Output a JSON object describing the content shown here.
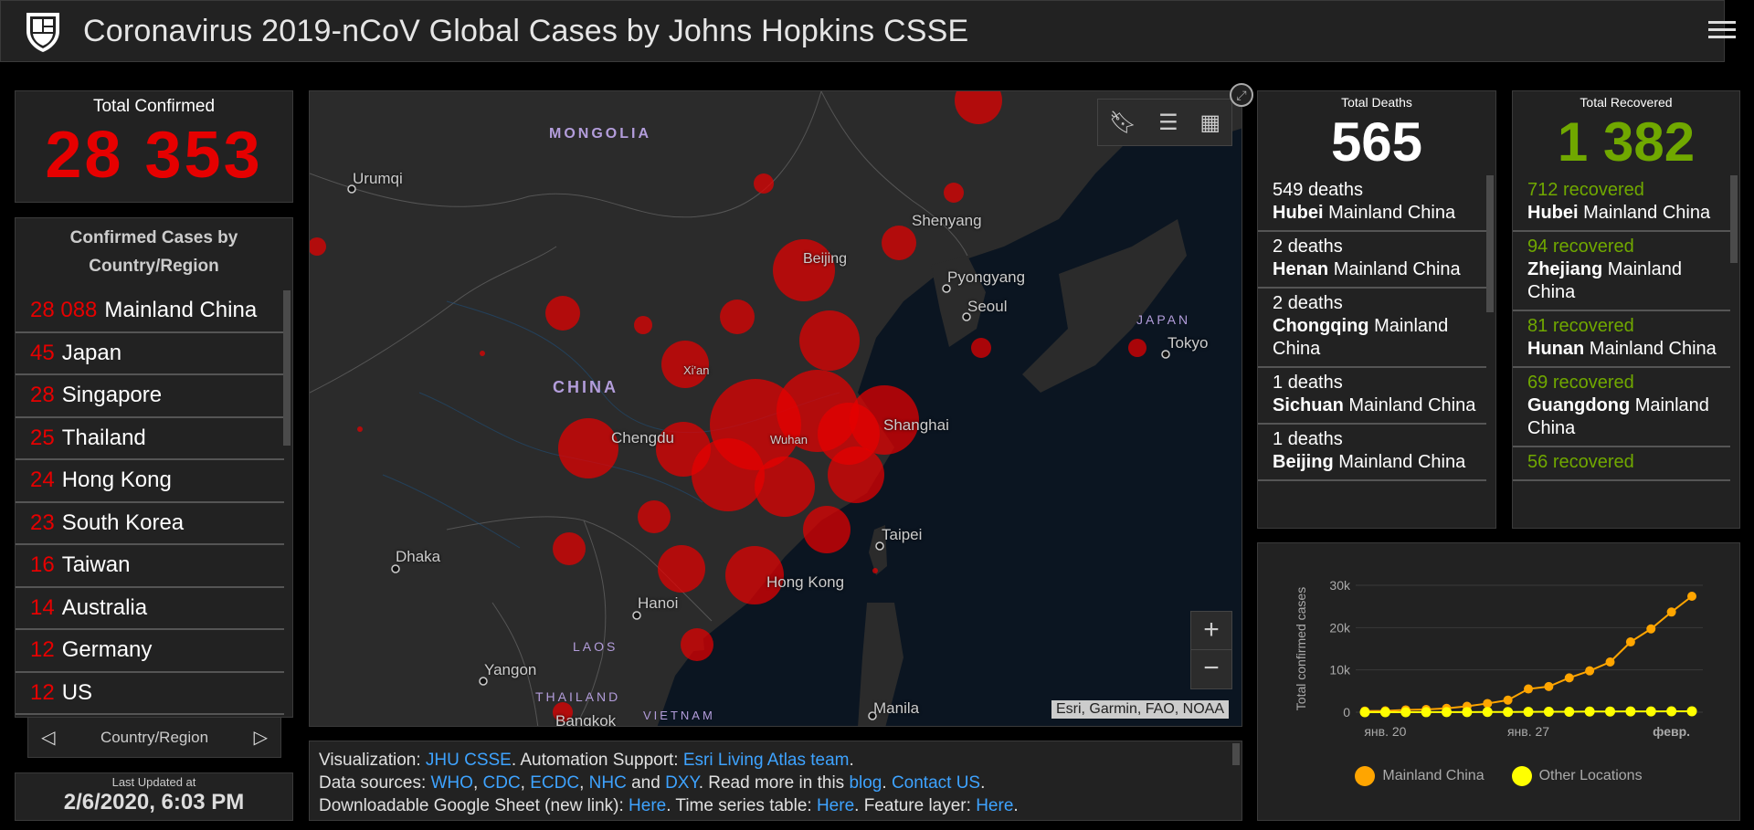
{
  "header": {
    "title": "Coronavirus 2019-nCoV Global Cases by Johns Hopkins CSSE"
  },
  "total_confirmed": {
    "label": "Total Confirmed",
    "value": "28 353"
  },
  "country_panel": {
    "title": "Confirmed Cases by Country/Region",
    "items": [
      {
        "count": "28 088",
        "name": "Mainland China"
      },
      {
        "count": "45",
        "name": "Japan"
      },
      {
        "count": "28",
        "name": "Singapore"
      },
      {
        "count": "25",
        "name": "Thailand"
      },
      {
        "count": "24",
        "name": "Hong Kong"
      },
      {
        "count": "23",
        "name": "South Korea"
      },
      {
        "count": "16",
        "name": "Taiwan"
      },
      {
        "count": "14",
        "name": "Australia"
      },
      {
        "count": "12",
        "name": "Germany"
      },
      {
        "count": "12",
        "name": "US"
      }
    ],
    "pager_label": "Country/Region"
  },
  "last_updated": {
    "label": "Last Updated at",
    "value": "2/6/2020, 6:03 PM"
  },
  "map": {
    "labels": {
      "mongolia": "MONGOLIA",
      "china": "CHINA",
      "japan": "JAPAN",
      "laos": "LAOS",
      "thailand": "THAILAND",
      "vietnam": "VIETNAM",
      "urumqi": "Urumqi",
      "shenyang": "Shenyang",
      "beijing": "Beijing",
      "pyongyang": "Pyongyang",
      "seoul": "Seoul",
      "tokyo": "Tokyo",
      "xian": "Xi'an",
      "chengdu": "Chengdu",
      "wuhan": "Wuhan",
      "shanghai": "Shanghai",
      "taipei": "Taipei",
      "dhaka": "Dhaka",
      "hanoi": "Hanoi",
      "hongkong": "Hong Kong",
      "yangon": "Yangon",
      "bangkok": "Bangkok",
      "manila": "Manila"
    },
    "attribution": "Esri, Garmin, FAO, NOAA",
    "tools": {
      "bookmark_icon": "bookmark-icon",
      "legend_icon": "list-icon",
      "basemap_icon": "basemap-gallery-icon"
    },
    "zoom_in": "+",
    "zoom_out": "−"
  },
  "info": {
    "visualization_label": "Visualization: ",
    "jhu": "JHU CSSE",
    "automation_label": ". Automation Support: ",
    "esri_team": "Esri Living Atlas team",
    "period": ".",
    "sources_label": "Data sources: ",
    "who": "WHO",
    "cdc": "CDC",
    "ecdc": "ECDC",
    "nhc": "NHC",
    "and": " and ",
    "dxy": "DXY",
    "read_more": ". Read more in this ",
    "blog": "blog",
    "contact": "Contact US",
    "sheet_label": "Downloadable Google Sheet (new link): ",
    "here1": "Here",
    "ts_label": ". Time series table: ",
    "here2": "Here",
    "fl_label": ". Feature layer: ",
    "here3": "Here"
  },
  "deaths": {
    "label": "Total Deaths",
    "value": "565",
    "items": [
      {
        "count": "549",
        "unit": "deaths",
        "region": "Hubei",
        "country": "Mainland China"
      },
      {
        "count": "2",
        "unit": "deaths",
        "region": "Henan",
        "country": "Mainland China"
      },
      {
        "count": "2",
        "unit": "deaths",
        "region": "Chongqing",
        "country": "Mainland China"
      },
      {
        "count": "1",
        "unit": "deaths",
        "region": "Sichuan",
        "country": "Mainland China"
      },
      {
        "count": "1",
        "unit": "deaths",
        "region": "Beijing",
        "country": "Mainland China"
      }
    ]
  },
  "recovered": {
    "label": "Total Recovered",
    "value": "1 382",
    "items": [
      {
        "count": "712",
        "unit": "recovered",
        "region": "Hubei",
        "country": "Mainland China"
      },
      {
        "count": "94",
        "unit": "recovered",
        "region": "Zhejiang",
        "country": "Mainland China"
      },
      {
        "count": "81",
        "unit": "recovered",
        "region": "Hunan",
        "country": "Mainland China"
      },
      {
        "count": "69",
        "unit": "recovered",
        "region": "Guangdong",
        "country": "Mainland China"
      },
      {
        "count": "56",
        "unit": "recovered",
        "region": "",
        "country": ""
      }
    ]
  },
  "colors": {
    "confirmed": "#e60000",
    "recovered": "#70a800",
    "mainland": "#ffa500",
    "other": "#ffff00",
    "link": "#3ea3ff"
  },
  "chart_data": {
    "type": "line",
    "ylabel": "Total confirmed cases",
    "xticks": [
      "янв. 20",
      "янв. 27",
      "февр."
    ],
    "yticks": [
      "0",
      "10k",
      "20k",
      "30k"
    ],
    "ylim": [
      0,
      30000
    ],
    "legend_position": "bottom",
    "series": [
      {
        "name": "Mainland China",
        "color": "#ffa500",
        "values": [
          278,
          326,
          547,
          639,
          916,
          1399,
          2062,
          2863,
          5494,
          6070,
          8124,
          9783,
          11871,
          16607,
          19693,
          23680,
          27409
        ]
      },
      {
        "name": "Other Locations",
        "color": "#ffff00",
        "values": [
          4,
          6,
          8,
          14,
          25,
          40,
          57,
          64,
          87,
          105,
          118,
          153,
          173,
          183,
          188,
          212,
          227
        ]
      }
    ]
  }
}
